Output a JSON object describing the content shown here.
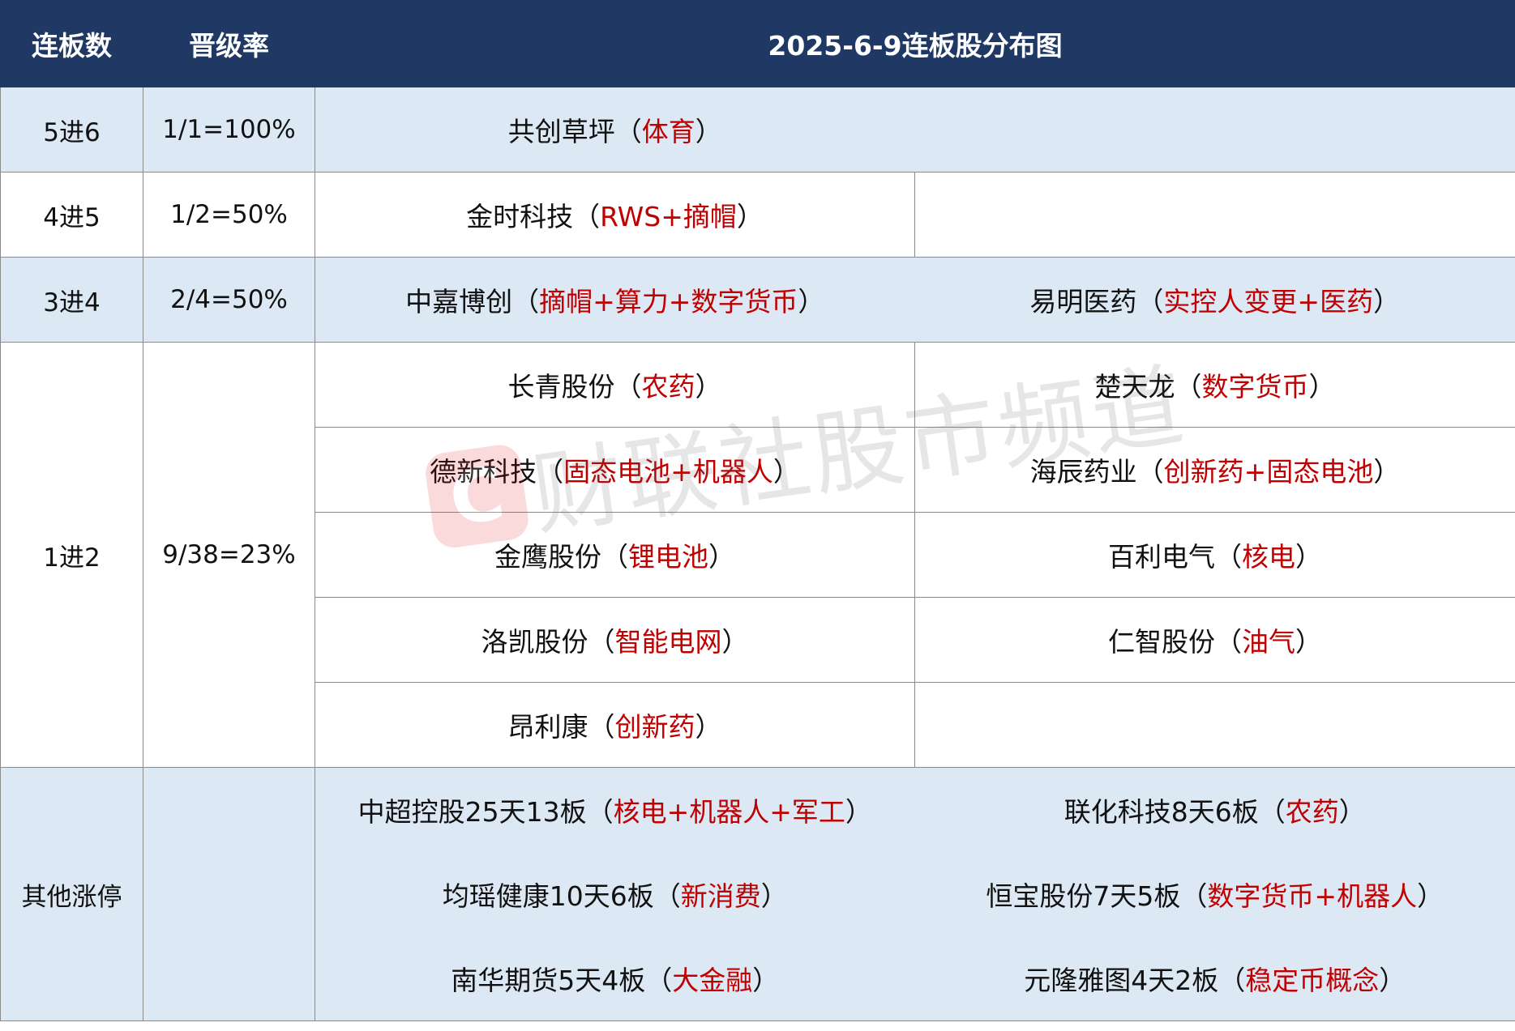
{
  "header": {
    "col1": "连板数",
    "col2": "晋级率",
    "col3": "2025-6-9连板股分布图"
  },
  "rows": {
    "r5": {
      "level": "5进6",
      "rate": "1/1=100%",
      "a": {
        "name": "共创草坪",
        "theme": "体育"
      }
    },
    "r4": {
      "level": "4进5",
      "rate": "1/2=50%",
      "a": {
        "name": "金时科技",
        "theme": "RWS+摘帽"
      }
    },
    "r3": {
      "level": "3进4",
      "rate": "2/4=50%",
      "a": {
        "name": "中嘉博创",
        "theme": "摘帽+算力+数字货币"
      },
      "b": {
        "name": "易明医药",
        "theme": "实控人变更+医药"
      }
    },
    "r1": {
      "level": "1进2",
      "rate": "9/38=23%",
      "s1": {
        "name": "长青股份",
        "theme": "农药"
      },
      "s2": {
        "name": "楚天龙",
        "theme": "数字货币"
      },
      "s3": {
        "name": "德新科技",
        "theme": "固态电池+机器人"
      },
      "s4": {
        "name": "海辰药业",
        "theme": "创新药+固态电池"
      },
      "s5": {
        "name": "金鹰股份",
        "theme": "锂电池"
      },
      "s6": {
        "name": "百利电气",
        "theme": "核电"
      },
      "s7": {
        "name": "洛凯股份",
        "theme": "智能电网"
      },
      "s8": {
        "name": "仁智股份",
        "theme": "油气"
      },
      "s9": {
        "name": "昂利康",
        "theme": "创新药"
      }
    },
    "other": {
      "level": "其他涨停",
      "rate": "",
      "s1": {
        "name": "中超控股25天13板",
        "theme": "核电+机器人+军工"
      },
      "s2": {
        "name": "联化科技8天6板",
        "theme": "农药"
      },
      "s3": {
        "name": "均瑶健康10天6板",
        "theme": "新消费"
      },
      "s4": {
        "name": "恒宝股份7天5板",
        "theme": "数字货币+机器人"
      },
      "s5": {
        "name": "南华期货5天4板",
        "theme": "大金融"
      },
      "s6": {
        "name": "元隆雅图4天2板",
        "theme": "稳定币概念"
      }
    }
  },
  "watermark": {
    "logo": "C",
    "text": "财联社股市频道"
  },
  "colors": {
    "header_bg": "#1f3864",
    "row_blue": "#dce9f5",
    "theme_red": "#c00000"
  }
}
